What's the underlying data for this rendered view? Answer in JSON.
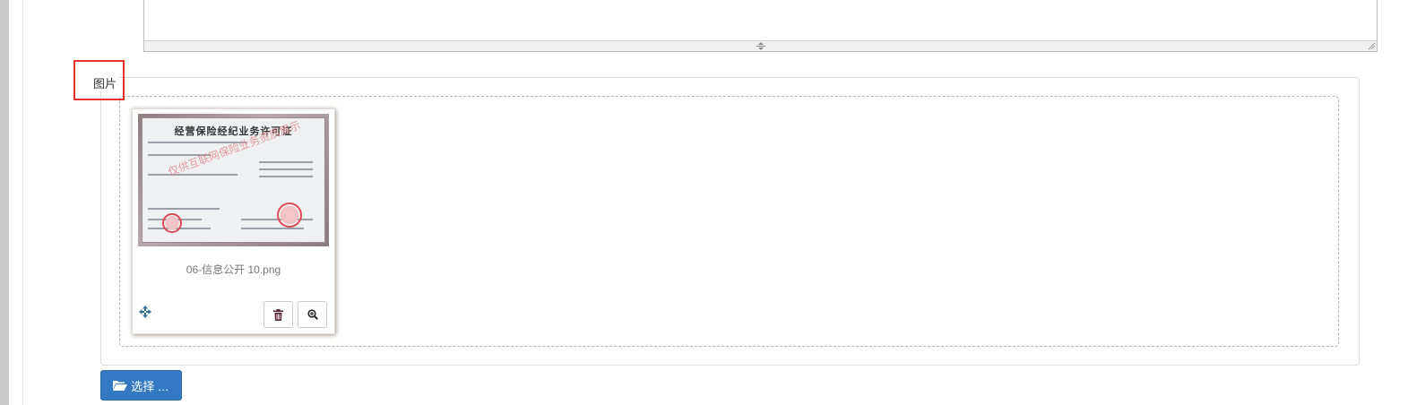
{
  "section": {
    "legend": "图片"
  },
  "file": {
    "name": "06-信息公开 10.png",
    "preview": {
      "title": "经营保险经纪业务许可证",
      "watermark": "仅供互联网保险业务资质展示"
    }
  },
  "actions": {
    "select_label": "选择 …",
    "delete_icon": "trash-icon",
    "zoom_icon": "zoom-in-icon",
    "move_icon": "move-icon",
    "folder_icon": "folder-open-icon"
  },
  "colors": {
    "highlight": "#e8312d",
    "primary_button": "#3379c1",
    "move_icon": "#31708f"
  }
}
